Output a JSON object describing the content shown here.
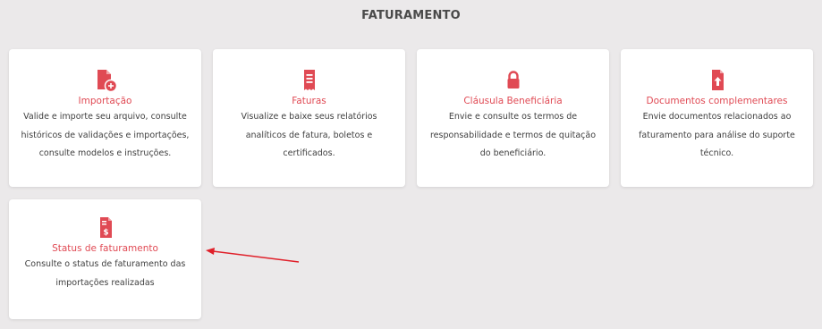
{
  "header": {
    "title": "FATURAMENTO"
  },
  "colors": {
    "accent": "#e04a54",
    "background": "#ebe9ea",
    "card": "#ffffff"
  },
  "cards": [
    {
      "icon": "file-plus-icon",
      "title": "Importação",
      "description": "Valide e importe seu arquivo, consulte históricos de validações e importações, consulte modelos e instruções."
    },
    {
      "icon": "receipt-icon",
      "title": "Faturas",
      "description": "Visualize e baixe seus relatórios analíticos de fatura, boletos e certificados."
    },
    {
      "icon": "lock-icon",
      "title": "Cláusula Beneficiária",
      "description": "Envie e consulte os termos de responsabilidade e termos de quitação do beneficiário."
    },
    {
      "icon": "file-upload-icon",
      "title": "Documentos complementares",
      "description": "Envie documentos relacionados ao faturamento para análise do suporte técnico."
    },
    {
      "icon": "invoice-dollar-icon",
      "title": "Status de faturamento",
      "description": "Consulte o status de faturamento das importações realizadas"
    }
  ]
}
